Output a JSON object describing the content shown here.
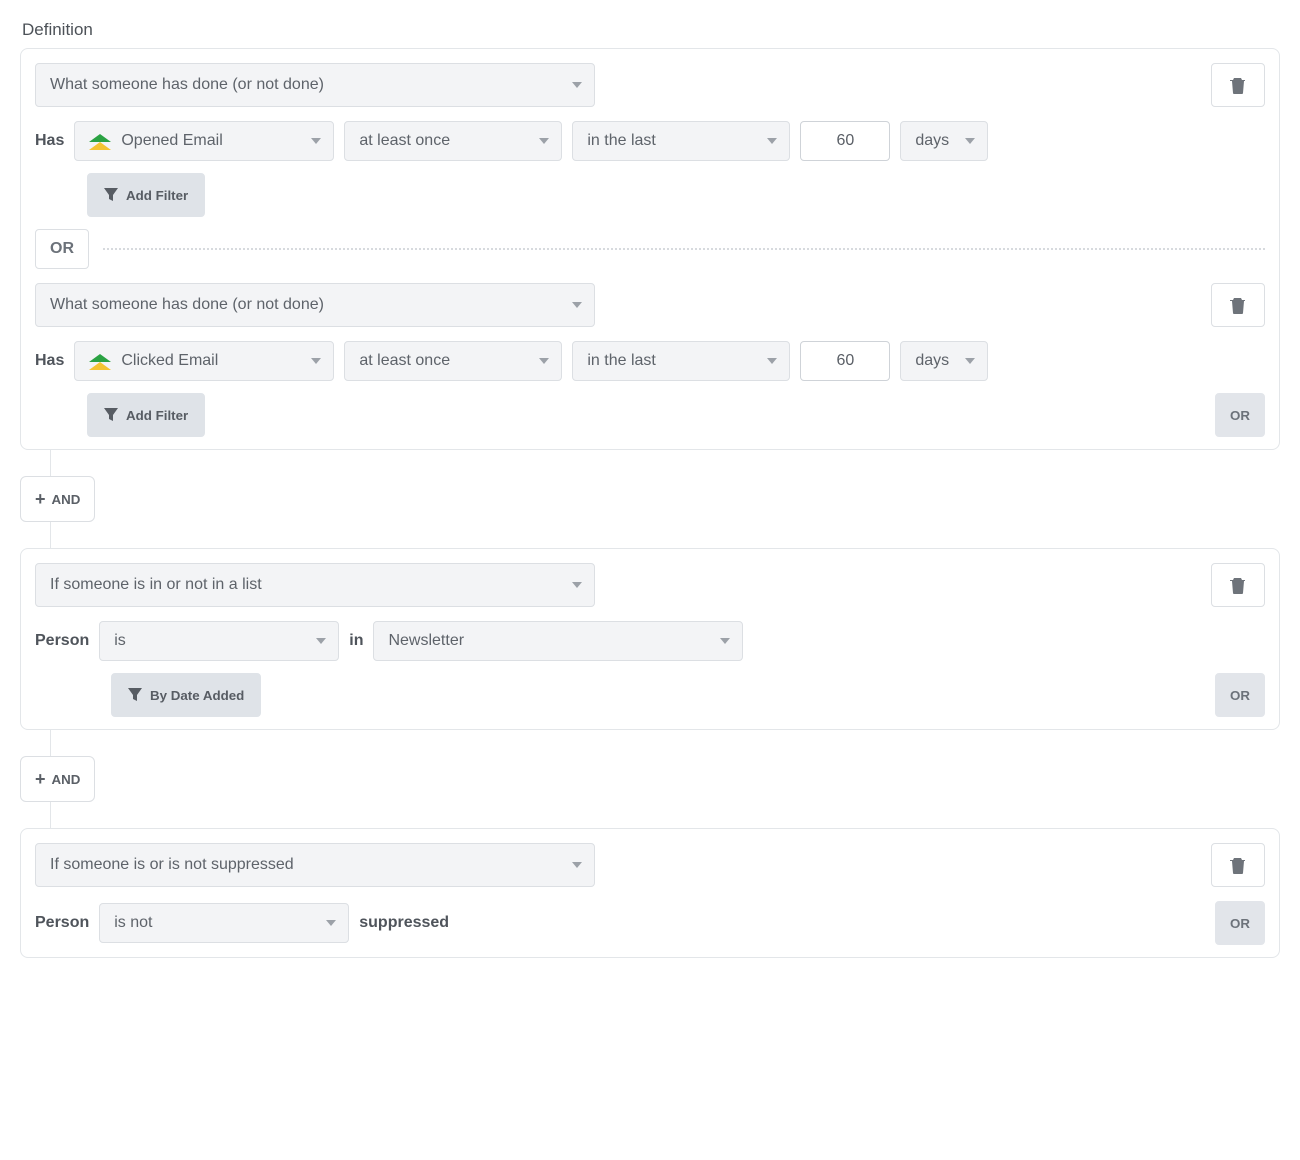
{
  "heading": "Definition",
  "labels": {
    "has": "Has",
    "person": "Person",
    "in": "in",
    "suppressed": "suppressed",
    "addFilter": "Add Filter",
    "byDateAdded": "By Date Added",
    "or": "OR",
    "and": "AND"
  },
  "groups": [
    {
      "conditions": [
        {
          "type": "What someone has done (or not done)",
          "event": "Opened Email",
          "frequency": "at least once",
          "range": "in the last",
          "value": "60",
          "unit": "days",
          "showAddFilter": true,
          "showOrButton": false
        },
        {
          "type": "What someone has done (or not done)",
          "event": "Clicked Email",
          "frequency": "at least once",
          "range": "in the last",
          "value": "60",
          "unit": "days",
          "showAddFilter": true,
          "showOrButton": true
        }
      ]
    },
    {
      "list": {
        "type": "If someone is in or not in a list",
        "op": "is",
        "listName": "Newsletter",
        "showByDateAdded": true,
        "showOrButton": true
      }
    },
    {
      "suppressed": {
        "type": "If someone is or is not suppressed",
        "op": "is not",
        "showOrButton": true
      }
    }
  ]
}
